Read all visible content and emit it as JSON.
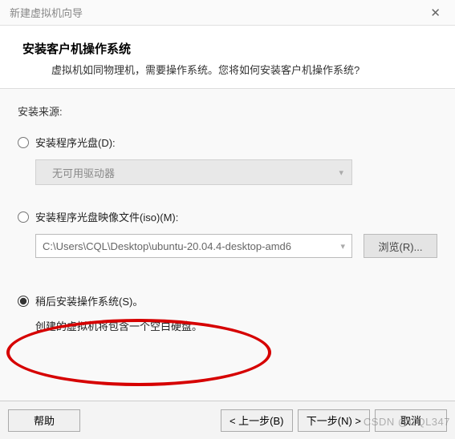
{
  "window": {
    "title": "新建虚拟机向导"
  },
  "header": {
    "title": "安装客户机操作系统",
    "subtitle": "虚拟机如同物理机，需要操作系统。您将如何安装客户机操作系统?"
  },
  "content": {
    "source_label": "安装来源:",
    "option_disc": {
      "label": "安装程序光盘(D):",
      "dropdown_value": "无可用驱动器"
    },
    "option_iso": {
      "label": "安装程序光盘映像文件(iso)(M):",
      "path": "C:\\Users\\CQL\\Desktop\\ubuntu-20.04.4-desktop-amd6",
      "browse_label": "浏览(R)..."
    },
    "option_later": {
      "label": "稍后安装操作系统(S)。",
      "description": "创建的虚拟机将包含一个空白硬盘。"
    }
  },
  "footer": {
    "help": "帮助",
    "back": "< 上一步(B)",
    "next": "下一步(N) >",
    "cancel": "取消"
  },
  "watermark": "CSDN @CQL347"
}
